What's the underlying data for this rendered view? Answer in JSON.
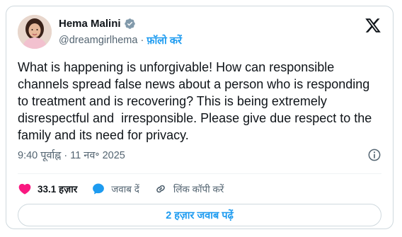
{
  "author": {
    "name": "Hema Malini",
    "handle": "@dreamgirlhema",
    "follow_label": "फ़ॉलो करें",
    "separator": "·"
  },
  "post": {
    "text": "What is happening is unforgivable! How can responsible channels spread false news about a person who is responding to treatment and is recovering? This is being extremely disrespectful and  irresponsible. Please give due respect to the family and its need for privacy.",
    "timestamp": "9:40 पूर्वाह्न · 11 नव॰ 2025"
  },
  "actions": {
    "like_count": "33.1 हज़ार",
    "reply_label": "जवाब दें",
    "copy_link_label": "लिंक कॉपी करें"
  },
  "replies_button": "2 हज़ार जवाब पढ़ें",
  "icons": {
    "verified": "verified-badge-icon",
    "x_logo": "x-logo-icon",
    "info": "info-icon",
    "like": "heart-icon",
    "reply": "speech-bubble-icon",
    "copy_link": "link-icon"
  },
  "colors": {
    "accent": "#1d9bf0",
    "like": "#f91880",
    "text": "#0f1419",
    "muted": "#536471",
    "border": "#cfd9de"
  }
}
